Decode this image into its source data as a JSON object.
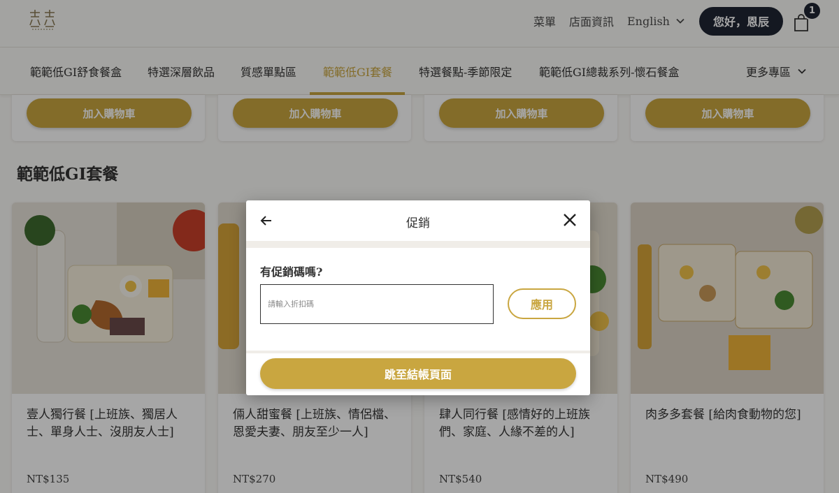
{
  "header": {
    "menu_label": "菜單",
    "store_info_label": "店面資訊",
    "language": "English",
    "user_greeting": "您好，恩辰",
    "cart_count": "1"
  },
  "nav": {
    "items": [
      {
        "label": "範範低GI舒食餐盒"
      },
      {
        "label": "特選深層飲品"
      },
      {
        "label": "質感單點區"
      },
      {
        "label": "範範低GI套餐"
      },
      {
        "label": "特選餐點-季節限定"
      },
      {
        "label": "範範低GI總裁系列-懷石餐盒"
      }
    ],
    "active_index": 3,
    "more_label": "更多專區"
  },
  "top_cards": {
    "add_to_cart_label": "加入購物車"
  },
  "section": {
    "title": "範範低GI套餐"
  },
  "products": [
    {
      "name": "壹人獨行餐 [上班族、獨居人士、單身人士、沒朋友人士]",
      "price": "NT$135"
    },
    {
      "name": "倆人甜蜜餐 [上班族、情侶檔、恩愛夫妻、朋友至少一人]",
      "price": "NT$270"
    },
    {
      "name": "肆人同行餐 [感情好的上班族們、家庭、人緣不差的人]",
      "price": "NT$540"
    },
    {
      "name": "肉多多套餐 [給肉食動物的您]",
      "price": "NT$490"
    }
  ],
  "modal": {
    "title": "促銷",
    "question": "有促銷碼嗎?",
    "input_placeholder": "請輸入折扣碼",
    "input_value": "",
    "apply_label": "應用",
    "checkout_label": "跳至結帳頁面"
  },
  "colors": {
    "accent": "#c9a640",
    "dark": "#1f2633",
    "background": "#fbfaf7"
  }
}
